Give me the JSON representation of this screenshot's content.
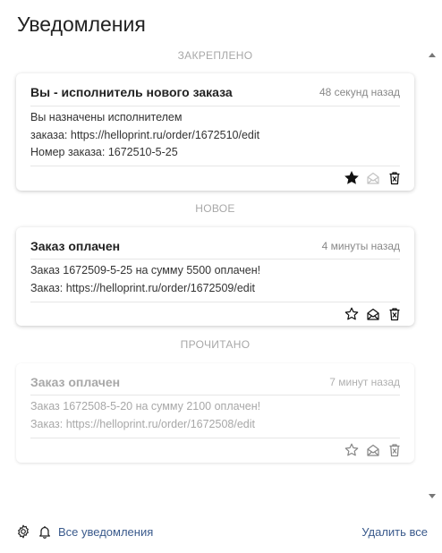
{
  "header": {
    "title": "Уведомления"
  },
  "sections": {
    "pinned": "ЗАКРЕПЛЕНО",
    "new": "НОВОЕ",
    "read": "ПРОЧИТАНО"
  },
  "cards": [
    {
      "title": "Вы - исполнитель нового заказа",
      "time": "48 секунд назад",
      "lines": [
        "Вы назначены исполнителем",
        "заказа: https://helloprint.ru/order/1672510/edit",
        "Номер заказа: 1672510-5-25"
      ]
    },
    {
      "title": "Заказ оплачен",
      "time": "4 минуты назад",
      "lines": [
        "Заказ 1672509-5-25 на сумму 5500 оплачен!",
        "Заказ: https://helloprint.ru/order/1672509/edit"
      ]
    },
    {
      "title": "Заказ оплачен",
      "time": "7 минут назад",
      "lines": [
        "Заказ 1672508-5-20 на сумму 2100 оплачен!",
        "Заказ: https://helloprint.ru/order/1672508/edit"
      ]
    }
  ],
  "footer": {
    "all_notifications": "Все уведомления",
    "delete_all": "Удалить все"
  },
  "icons": {
    "pin": "star-icon",
    "mark_read": "envelope-open-icon",
    "delete": "trash-icon",
    "settings": "gear-icon",
    "bell": "bell-icon"
  },
  "colors": {
    "link": "#3a5a8c",
    "muted": "#a8a8a8"
  }
}
